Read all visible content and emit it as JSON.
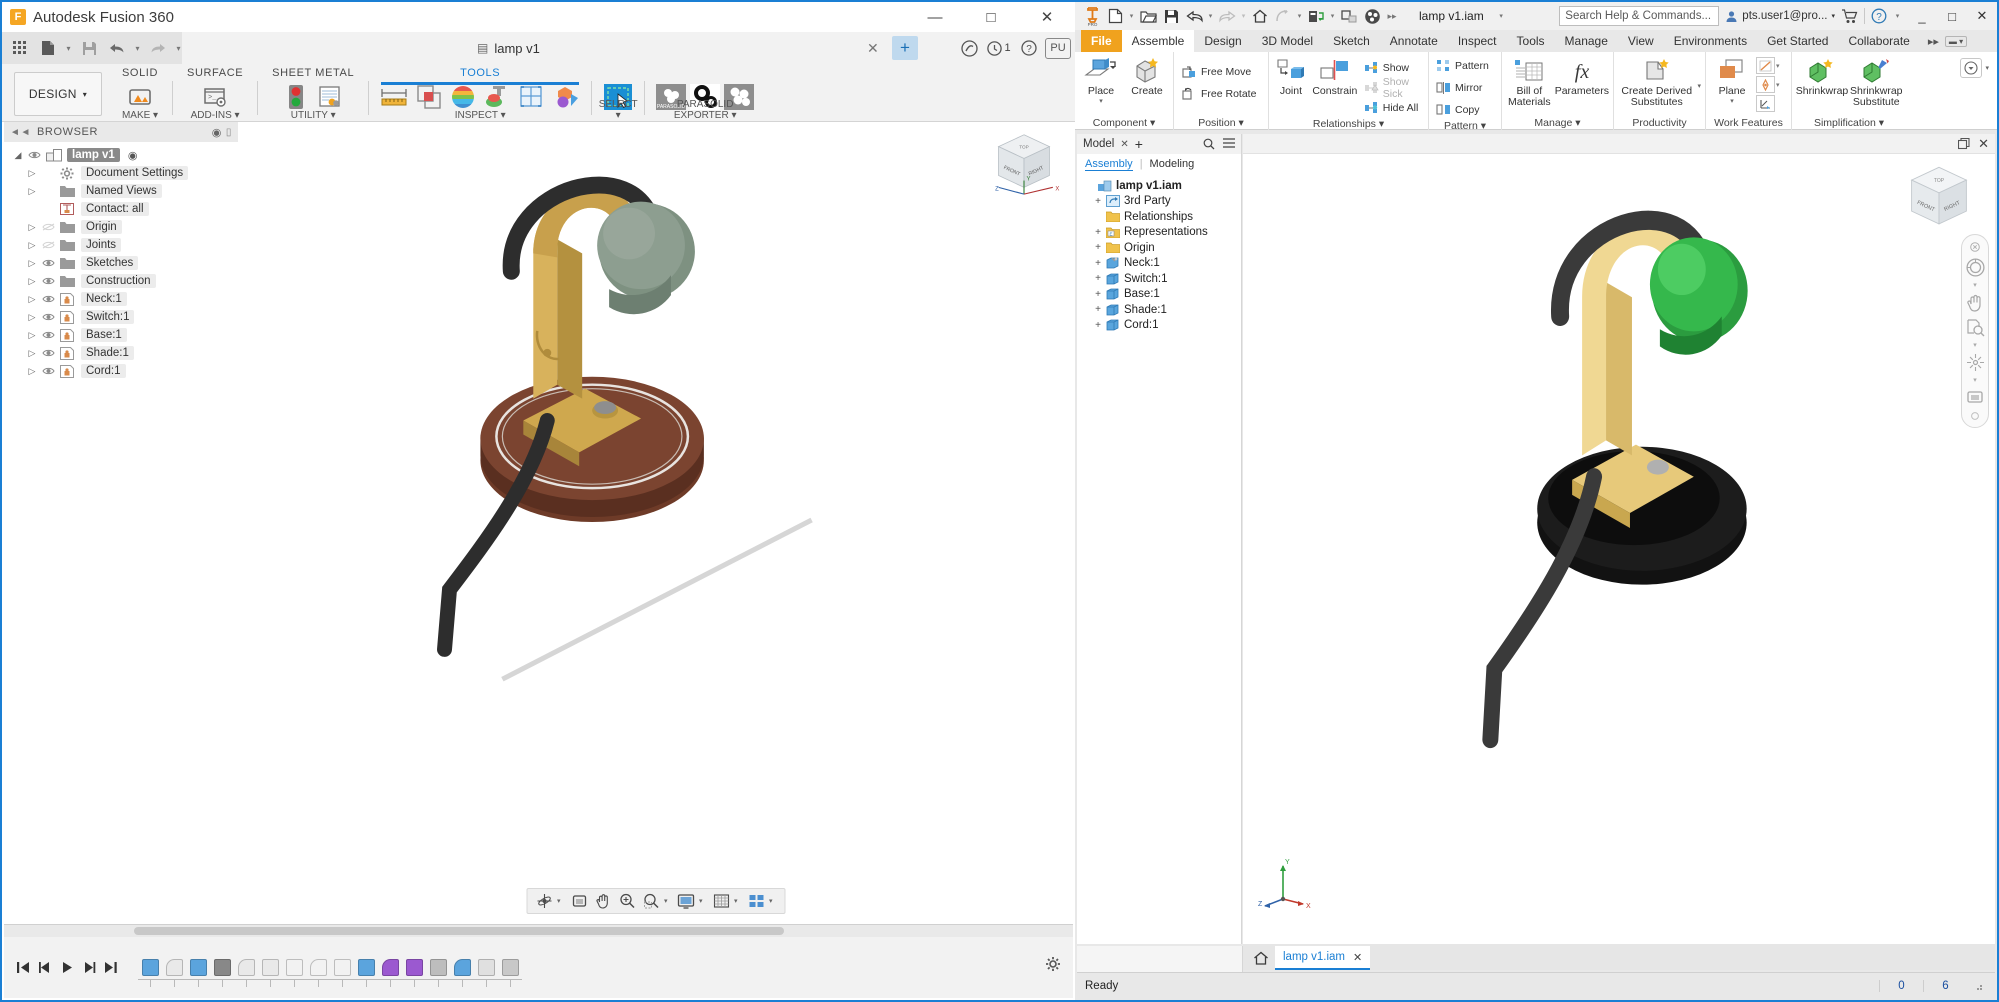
{
  "fusion": {
    "app_title": "Autodesk Fusion 360",
    "logo_text": "F",
    "window_buttons": {
      "minimize": "—",
      "maximize": "□",
      "close": "✕"
    },
    "quick_access": {
      "grid_icon": "grid-icon",
      "new_icon": "new-doc-icon",
      "save_icon": "save-icon",
      "undo_icon": "undo-icon",
      "redo_icon": "redo-icon",
      "caret": "▾"
    },
    "document_tab": {
      "label": "lamp v1",
      "close": "✕",
      "add": "+"
    },
    "qat_right": {
      "extensions": "◔",
      "notifications_count": "1",
      "help": "?",
      "profile": "PU"
    },
    "design_button": {
      "label": "DESIGN",
      "caret": "▾"
    },
    "workspace_tabs": [
      {
        "label": "SOLID",
        "active": false
      },
      {
        "label": "SURFACE",
        "active": false
      },
      {
        "label": "SHEET METAL",
        "active": false
      },
      {
        "label": "TOOLS",
        "active": true
      }
    ],
    "ribbon_groups": [
      {
        "label": "MAKE ▾"
      },
      {
        "label": "ADD-INS ▾"
      },
      {
        "label": "UTILITY ▾"
      },
      {
        "label": "INSPECT ▾"
      },
      {
        "label": "SELECT ▾"
      },
      {
        "label": "PARASOLID EXPORTER ▾"
      }
    ],
    "browser": {
      "title": "BROWSER",
      "collapse_icon": "collapse-left-icon",
      "tree": [
        {
          "label": "lamp v1",
          "depth": 0,
          "tri": "◢",
          "eye": "visible",
          "icon": "assembly-icon",
          "root": true,
          "trailing": "◉"
        },
        {
          "label": "Document Settings",
          "depth": 1,
          "tri": "▷",
          "eye": "none",
          "icon": "gear-icon"
        },
        {
          "label": "Named Views",
          "depth": 1,
          "tri": "▷",
          "eye": "none",
          "icon": "folder-icon"
        },
        {
          "label": "Contact: all",
          "depth": 1,
          "tri": "",
          "eye": "none",
          "icon": "contact-icon"
        },
        {
          "label": "Origin",
          "depth": 1,
          "tri": "▷",
          "eye": "hidden",
          "icon": "folder-icon"
        },
        {
          "label": "Joints",
          "depth": 1,
          "tri": "▷",
          "eye": "hidden",
          "icon": "folder-icon"
        },
        {
          "label": "Sketches",
          "depth": 1,
          "tri": "▷",
          "eye": "visible",
          "icon": "folder-icon"
        },
        {
          "label": "Construction",
          "depth": 1,
          "tri": "▷",
          "eye": "visible",
          "icon": "folder-icon"
        },
        {
          "label": "Neck:1",
          "depth": 1,
          "tri": "▷",
          "eye": "visible",
          "icon": "component-icon"
        },
        {
          "label": "Switch:1",
          "depth": 1,
          "tri": "▷",
          "eye": "visible",
          "icon": "component-icon"
        },
        {
          "label": "Base:1",
          "depth": 1,
          "tri": "▷",
          "eye": "visible",
          "icon": "component-icon"
        },
        {
          "label": "Shade:1",
          "depth": 1,
          "tri": "▷",
          "eye": "visible",
          "icon": "component-icon"
        },
        {
          "label": "Cord:1",
          "depth": 1,
          "tri": "▷",
          "eye": "visible",
          "icon": "component-icon"
        }
      ]
    },
    "viewcube": {
      "front": "FRONT",
      "right": "RIGHT",
      "top": "TOP",
      "axis_x": "X",
      "axis_y": "Y",
      "axis_z": "Z"
    },
    "navbar": [
      {
        "icon": "orbit-icon",
        "caret": true
      },
      {
        "icon": "look-at-icon",
        "caret": false
      },
      {
        "icon": "pan-icon",
        "caret": false
      },
      {
        "icon": "zoom-in-icon",
        "caret": false
      },
      {
        "icon": "zoom-window-icon",
        "caret": true
      },
      {
        "icon": "display-settings-icon",
        "caret": true
      },
      {
        "icon": "grid-snaps-icon",
        "caret": true
      },
      {
        "icon": "viewports-icon",
        "caret": true
      }
    ],
    "timeline": {
      "controls": [
        "go-to-beginning-icon",
        "step-back-icon",
        "play-icon",
        "step-forward-icon",
        "go-to-end-icon"
      ],
      "node_count": 16,
      "settings_icon": "gear-icon"
    },
    "model_colors": {
      "brass": "#cfa84e",
      "brass_light": "#e2c878",
      "wood": "#6e3b28",
      "wood_light": "#8a4a32",
      "shade_green": "#7e9181",
      "cord_black": "#2d2d2d"
    }
  },
  "inventor": {
    "quick_access": {
      "app_icon": "inventor-pro-icon",
      "new": "new-icon",
      "open": "open-folder-icon",
      "save": "save-icon",
      "undo": "undo-icon",
      "redo": "redo-icon",
      "home": "home-icon",
      "return": "return-icon",
      "update": "update-icon",
      "select": "select-icon",
      "material": "appearance-icon",
      "overflow": "▸▸",
      "caret": "▾"
    },
    "document_name": "lamp v1.iam",
    "search": {
      "placeholder": "Search Help & Commands...",
      "icon": "search-icon"
    },
    "account": {
      "name": "pts.user1@pro...",
      "caret": "▾",
      "avatar_icon": "user-icon"
    },
    "cart_icon": "cart-icon",
    "help_icon": "help-icon",
    "window_buttons": {
      "minimize": "_",
      "maximize": "□",
      "close": "✕"
    },
    "ribbon_tabs": [
      {
        "label": "File",
        "type": "file"
      },
      {
        "label": "Assemble",
        "type": "active"
      },
      {
        "label": "Design",
        "type": "normal"
      },
      {
        "label": "3D Model",
        "type": "normal"
      },
      {
        "label": "Sketch",
        "type": "normal"
      },
      {
        "label": "Annotate",
        "type": "normal"
      },
      {
        "label": "Inspect",
        "type": "normal"
      },
      {
        "label": "Tools",
        "type": "normal"
      },
      {
        "label": "Manage",
        "type": "normal"
      },
      {
        "label": "View",
        "type": "normal"
      },
      {
        "label": "Environments",
        "type": "normal"
      },
      {
        "label": "Get Started",
        "type": "normal"
      },
      {
        "label": "Collaborate",
        "type": "normal"
      }
    ],
    "ribbon_overflow": "▸▸",
    "ribbon_minimize": "▾",
    "panels": [
      {
        "name": "Component",
        "label": "Component ▾",
        "big": [
          {
            "label": "Place",
            "icon": "place-component-icon",
            "caret": "▾"
          },
          {
            "label": "Create",
            "icon": "create-component-icon"
          }
        ],
        "small": []
      },
      {
        "name": "Position",
        "label": "Position ▾",
        "big": [],
        "small": [
          {
            "label": "Free Move",
            "icon": "free-move-icon",
            "disabled": false
          },
          {
            "label": "Free Rotate",
            "icon": "free-rotate-icon",
            "disabled": false
          }
        ]
      },
      {
        "name": "Relationships",
        "label": "Relationships ▾",
        "big": [
          {
            "label": "Joint",
            "icon": "joint-icon"
          },
          {
            "label": "Constrain",
            "icon": "constrain-icon"
          }
        ],
        "small": [
          {
            "label": "Show",
            "icon": "show-relationships-icon",
            "disabled": false
          },
          {
            "label": "Show Sick",
            "icon": "show-sick-icon",
            "disabled": true
          },
          {
            "label": "Hide All",
            "icon": "hide-all-icon",
            "disabled": false
          }
        ]
      },
      {
        "name": "Pattern",
        "label": "Pattern ▾",
        "big": [],
        "small": [
          {
            "label": "Pattern",
            "icon": "pattern-icon",
            "disabled": false
          },
          {
            "label": "Mirror",
            "icon": "mirror-icon",
            "disabled": false
          },
          {
            "label": "Copy",
            "icon": "copy-icon",
            "disabled": false
          }
        ]
      },
      {
        "name": "Manage",
        "label": "Manage ▾",
        "big": [
          {
            "label": "Bill of Materials",
            "icon": "bom-icon"
          },
          {
            "label": "Parameters",
            "icon": "parameters-icon"
          }
        ],
        "small": []
      },
      {
        "name": "Productivity",
        "label": "Productivity",
        "big": [
          {
            "label": "Create Derived Substitutes",
            "icon": "derived-substitute-icon",
            "caret": "▾"
          }
        ],
        "small": []
      },
      {
        "name": "Work Features",
        "label": "Work Features",
        "big": [
          {
            "label": "Plane",
            "icon": "work-plane-icon",
            "caret": "▾"
          }
        ],
        "small": [
          {
            "label": "",
            "icon": "work-axis-icon",
            "disabled": false
          },
          {
            "label": "",
            "icon": "work-point-icon",
            "disabled": false
          },
          {
            "label": "",
            "icon": "ucs-icon",
            "disabled": false
          }
        ]
      },
      {
        "name": "Simplification",
        "label": "Simplification ▾",
        "big": [
          {
            "label": "Shrinkwrap",
            "icon": "shrinkwrap-icon"
          },
          {
            "label": "Shrinkwrap Substitute",
            "icon": "shrinkwrap-substitute-icon"
          }
        ],
        "small": []
      }
    ],
    "browser": {
      "tab_label": "Model",
      "tab_close": "✕",
      "tab_add": "+",
      "search_icon": "search-icon",
      "menu_icon": "hamburger-icon",
      "subtabs": [
        {
          "label": "Assembly",
          "active": true
        },
        {
          "label": "Modeling",
          "active": false
        }
      ],
      "tree": [
        {
          "label": "lamp v1.iam",
          "depth": 0,
          "expander": "",
          "icon": "assembly-icon",
          "root": true
        },
        {
          "label": "3rd Party",
          "depth": 1,
          "expander": "+",
          "icon": "third-party-icon"
        },
        {
          "label": "Relationships",
          "depth": 1,
          "expander": "",
          "icon": "folder-icon"
        },
        {
          "label": "Representations",
          "depth": 1,
          "expander": "+",
          "icon": "representations-icon"
        },
        {
          "label": "Origin",
          "depth": 1,
          "expander": "+",
          "icon": "folder-icon"
        },
        {
          "label": "Neck:1",
          "depth": 1,
          "expander": "+",
          "icon": "part-weld-icon"
        },
        {
          "label": "Switch:1",
          "depth": 1,
          "expander": "+",
          "icon": "part-icon"
        },
        {
          "label": "Base:1",
          "depth": 1,
          "expander": "+",
          "icon": "part-icon"
        },
        {
          "label": "Shade:1",
          "depth": 1,
          "expander": "+",
          "icon": "part-icon"
        },
        {
          "label": "Cord:1",
          "depth": 1,
          "expander": "+",
          "icon": "part-icon"
        }
      ]
    },
    "canvas_top": {
      "restore_icon": "restore-icon",
      "close_icon": "close-icon"
    },
    "viewcube": {
      "front": "FRONT",
      "right": "RIGHT",
      "top": "TOP"
    },
    "axis_triad": {
      "x": "X",
      "y": "Y",
      "z": "Z"
    },
    "nav_panel": [
      {
        "icon": "close-small-icon"
      },
      {
        "icon": "steering-wheel-icon",
        "caret": true
      },
      {
        "icon": "pan-icon"
      },
      {
        "icon": "zoom-icon",
        "caret": true
      },
      {
        "icon": "orbit-icon",
        "caret": true
      },
      {
        "icon": "look-at-icon"
      }
    ],
    "doc_tabs": {
      "home_icon": "home-icon",
      "tabs": [
        {
          "label": "lamp v1.iam",
          "close": "✕",
          "active": true
        }
      ]
    },
    "status_bar": {
      "message": "Ready",
      "cell_1": "0",
      "cell_2": "6",
      "grip": "resize-grip-icon"
    },
    "model_colors": {
      "brass": "#e7c97a",
      "brass_dark": "#c9a74f",
      "shade_green": "#32b14a",
      "base_black": "#141414",
      "cord_black": "#3a3a3a"
    }
  }
}
